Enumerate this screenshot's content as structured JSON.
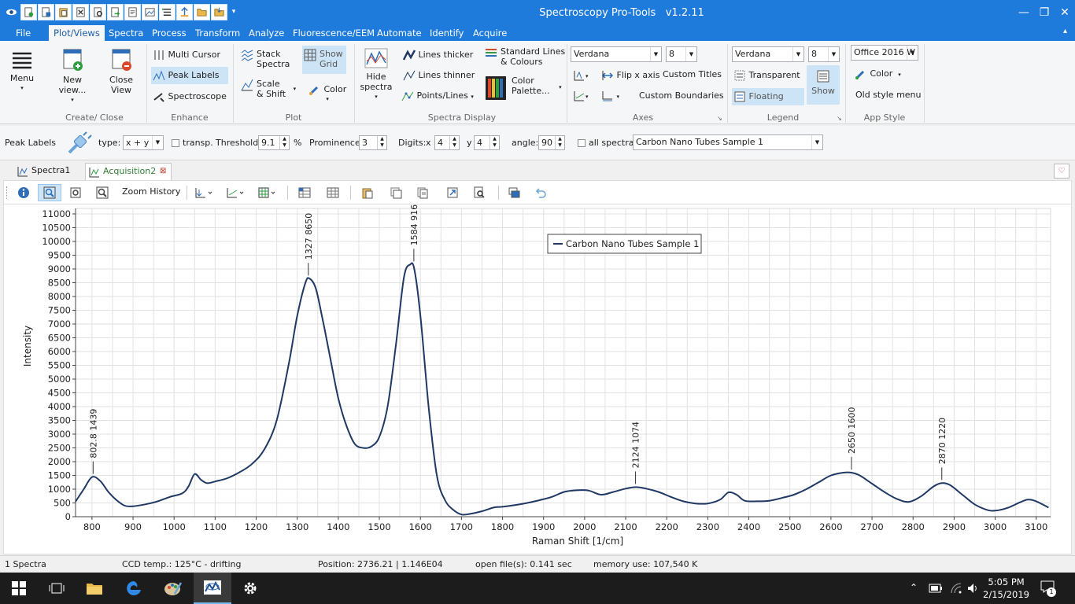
{
  "app": {
    "title": "Spectroscopy Pro-Tools",
    "version": "v1.2.11"
  },
  "menu_items": [
    "File",
    "Plot/Views",
    "Spectra",
    "Process",
    "Transform",
    "Analyze",
    "Fluorescence/EEM",
    "Automate",
    "Identify",
    "Acquire"
  ],
  "ribbon": {
    "menu_label": "Menu",
    "new_view": "New view...",
    "close_view_1": "Close",
    "close_view_2": "View",
    "group_create": "Create/ Close",
    "multi_cursor": "Multi Cursor",
    "peak_labels": "Peak Labels",
    "spectroscope": "Spectroscope",
    "group_enhance": "Enhance",
    "stack_1": "Stack",
    "stack_2": "Spectra",
    "show_grid_1": "Show",
    "show_grid_2": "Grid",
    "scale_1": "Scale",
    "scale_2": "& Shift",
    "color": "Color",
    "group_plot": "Plot",
    "hide_1": "Hide",
    "hide_2": "spectra",
    "lines_thicker": "Lines thicker",
    "lines_thinner": "Lines thinner",
    "points_lines": "Points/Lines",
    "standard_lines_1": "Standard Lines",
    "standard_lines_2": "& Colours",
    "color_palette_1": "Color",
    "color_palette_2": "Palette...",
    "group_spectra_display": "Spectra Display",
    "axes_font": "Verdana",
    "axes_size": "8",
    "flip_x": "Flip x axis",
    "custom_titles": "Custom Titles",
    "custom_boundaries": "Custom Boundaries",
    "group_axes": "Axes",
    "legend_font": "Verdana",
    "legend_size": "8",
    "transparent": "Transparent",
    "floating": "Floating",
    "show": "Show",
    "group_legend": "Legend",
    "style_combo": "Office 2016 W",
    "style_color": "Color",
    "old_style": "Old style menu",
    "group_app_style": "App Style"
  },
  "peakbar": {
    "title": "Peak Labels",
    "type_label": "type:",
    "type_value": "x + y",
    "transp_label": "transp.",
    "threshold_label": "Threshold:",
    "threshold_value": "9.1",
    "percent": "%",
    "prominence_label": "Prominence:",
    "prominence_value": "3",
    "digits_label": "Digits:",
    "x_label": "x",
    "x_value": "4",
    "y_label": "y",
    "y_value": "4",
    "angle_label": "angle:",
    "angle_value": "90",
    "all_spectra_label": "all spectra",
    "spectrum_select": "Carbon Nano Tubes Sample 1"
  },
  "tabs": [
    {
      "label": "Spectra1"
    },
    {
      "label": "Acquisition2"
    }
  ],
  "toolbar": {
    "zoom_history": "Zoom History"
  },
  "status": {
    "count": "1 Spectra",
    "ccd": "CCD temp.: 125°C - drifting",
    "position": "Position: 2736.21  |  1.146E04",
    "open_files": "open file(s): 0.141 sec",
    "memory": "memory use: 107,540 K"
  },
  "taskbar": {
    "time": "5:05 PM",
    "date": "2/15/2019",
    "notifications": "1"
  },
  "colors": {
    "accent": "#1e7bdc",
    "series": "#1f3864"
  },
  "chart_data": {
    "type": "line",
    "xlabel": "Raman Shift [1/cm]",
    "ylabel": "Intensity",
    "xlim": [
      760,
      3135
    ],
    "ylim": [
      0,
      11200
    ],
    "x_ticks": [
      800,
      900,
      1000,
      1100,
      1200,
      1300,
      1400,
      1500,
      1600,
      1700,
      1800,
      1900,
      2000,
      2100,
      2200,
      2300,
      2400,
      2500,
      2600,
      2700,
      2800,
      2900,
      3000,
      3100
    ],
    "y_ticks": [
      0,
      500,
      1000,
      1500,
      2000,
      2500,
      3000,
      3500,
      4000,
      4500,
      5000,
      5500,
      6000,
      6500,
      7000,
      7500,
      8000,
      8500,
      9000,
      9500,
      10000,
      10500,
      11000
    ],
    "grid": true,
    "legend_position": "top-center",
    "series": [
      {
        "name": "Carbon Nano Tubes Sample 1",
        "x": [
          760,
          780,
          800,
          820,
          840,
          860,
          880,
          900,
          930,
          960,
          990,
          1020,
          1035,
          1050,
          1065,
          1080,
          1100,
          1130,
          1160,
          1190,
          1220,
          1250,
          1280,
          1300,
          1320,
          1330,
          1345,
          1360,
          1380,
          1400,
          1420,
          1440,
          1460,
          1480,
          1500,
          1520,
          1540,
          1560,
          1575,
          1585,
          1600,
          1620,
          1640,
          1660,
          1680,
          1700,
          1720,
          1750,
          1780,
          1800,
          1830,
          1860,
          1890,
          1920,
          1950,
          1980,
          2010,
          2040,
          2070,
          2100,
          2125,
          2150,
          2180,
          2210,
          2240,
          2270,
          2300,
          2330,
          2350,
          2370,
          2390,
          2420,
          2450,
          2480,
          2510,
          2540,
          2570,
          2600,
          2630,
          2650,
          2670,
          2700,
          2730,
          2760,
          2790,
          2820,
          2850,
          2870,
          2890,
          2920,
          2950,
          2980,
          3000,
          3030,
          3060,
          3080,
          3100,
          3130
        ],
        "y": [
          550,
          1000,
          1440,
          1300,
          900,
          600,
          400,
          380,
          450,
          560,
          720,
          850,
          1100,
          1550,
          1350,
          1220,
          1280,
          1400,
          1620,
          1920,
          2450,
          3500,
          5600,
          7300,
          8500,
          8650,
          8300,
          7300,
          5800,
          4300,
          3300,
          2650,
          2500,
          2550,
          2900,
          4000,
          6200,
          8700,
          9160,
          9000,
          7300,
          4000,
          1500,
          600,
          250,
          80,
          100,
          200,
          340,
          360,
          420,
          500,
          600,
          720,
          900,
          960,
          950,
          800,
          900,
          1020,
          1074,
          1020,
          900,
          720,
          560,
          480,
          480,
          620,
          880,
          800,
          580,
          560,
          580,
          680,
          800,
          1000,
          1250,
          1500,
          1600,
          1600,
          1500,
          1200,
          900,
          650,
          540,
          750,
          1100,
          1220,
          1150,
          800,
          450,
          250,
          220,
          320,
          520,
          620,
          560,
          330
        ]
      }
    ],
    "peak_labels": [
      {
        "x": 802.8,
        "y": 1439,
        "text": "802.8  1439"
      },
      {
        "x": 1327,
        "y": 8650,
        "text": "1327  8650"
      },
      {
        "x": 1584,
        "y": 9160,
        "text": "1584  9160"
      },
      {
        "x": 2124,
        "y": 1074,
        "text": "2124  1074"
      },
      {
        "x": 2650,
        "y": 1600,
        "text": "2650  1600"
      },
      {
        "x": 2870,
        "y": 1220,
        "text": "2870  1220"
      }
    ]
  }
}
